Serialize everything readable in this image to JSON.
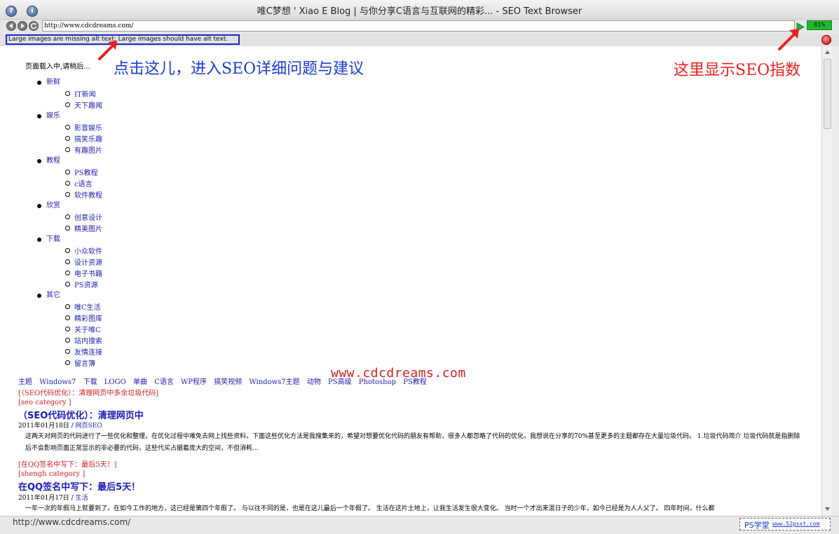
{
  "window": {
    "title": "唯C梦想 ' Xiao E Blog | 与你分享C语言与互联网的精彩... - SEO Text Browser",
    "help_button": "?",
    "info_button": "i"
  },
  "toolbar": {
    "url": "http://www.cdcdreams.com/",
    "seo_score": "81%"
  },
  "issue_bar": {
    "message": "Large images are missing alt text; Large images should have alt text."
  },
  "annotations": {
    "click_here": "点击这儿，进入SEO详细问题与建议",
    "score_here": "这里显示SEO指数",
    "watermark": "www.cdcdreams.com"
  },
  "page": {
    "loading": "页面载入中,请稍后...",
    "nav": [
      {
        "label": "新鲜",
        "items": [
          "IT新闻",
          "天下趣闻"
        ]
      },
      {
        "label": "娱乐",
        "items": [
          "影音娱乐",
          "搞笑乐趣",
          "有趣图片"
        ]
      },
      {
        "label": "教程",
        "items": [
          "PS教程",
          "c语言",
          "软件教程"
        ]
      },
      {
        "label": "欣赏",
        "items": [
          "创意设计",
          "精美图片"
        ]
      },
      {
        "label": "下载",
        "items": [
          "小众软件",
          "设计资源",
          "电子书籍",
          "PS资源"
        ]
      },
      {
        "label": "其它",
        "items": [
          "唯C生活",
          "精彩图库",
          "关于唯C",
          "站内搜索",
          "友情连接",
          "留言簿"
        ]
      }
    ],
    "tags": [
      "主题",
      "Windows7",
      "下载",
      "LOGO",
      "单曲",
      "C语言",
      "WP程序",
      "搞笑视频",
      "Windows7主题",
      "动物",
      "PS高级",
      "Photoshop",
      "PS教程"
    ],
    "posts": [
      {
        "link": "[（SEO代码优化）：清理网页中多余垃圾代码]",
        "category_tag": "[seo category ]",
        "title": "（SEO代码优化）：清理网页中",
        "date": "2011年01月18日",
        "sep": " / ",
        "category": "网页SEO",
        "body": "这两天对网页的代码进行了一些优化和整理，在优化过程中难免去网上找些资料，下面这些优化方法是我搜集来的，希望对想要优化代码的朋友有帮助，很多人都忽略了代码的优化，我想说在分享的70%甚至更多的主题都存在大量垃圾代码。 1.垃圾代码简介 垃圾代码就是指删除后不会影响页面正常显示的非必要的代码，这些代买占据着庞大的空间，不但消耗..."
      },
      {
        "link": "[在QQ签名中写下：最后5天！]",
        "category_tag": "[shengh category ]",
        "title": "在QQ签名中写下：最后5天！",
        "date": "2011年01月17日",
        "sep": " / ",
        "category": "生活",
        "body": "一年一次的年假马上就要到了，在如今工作的地方，这已经是第四个年假了。 与以往不同的是，也是在这儿最后一个年假了。 生活在这片土地上，让我生活发生很大变化。 当时一个才出来混日子的少年，如今已经是为人人父了。 四年时间，什么都"
      }
    ]
  },
  "statusbar": {
    "url": "http://www.cdcdreams.com/",
    "logo_text": "PS学堂",
    "logo_url": "www.52psxt.com"
  },
  "colors": {
    "link_blue": "#1e1ea8",
    "annotation_blue": "#1a3bd0",
    "annotation_red": "#ea2020",
    "score_green": "#22b830"
  }
}
